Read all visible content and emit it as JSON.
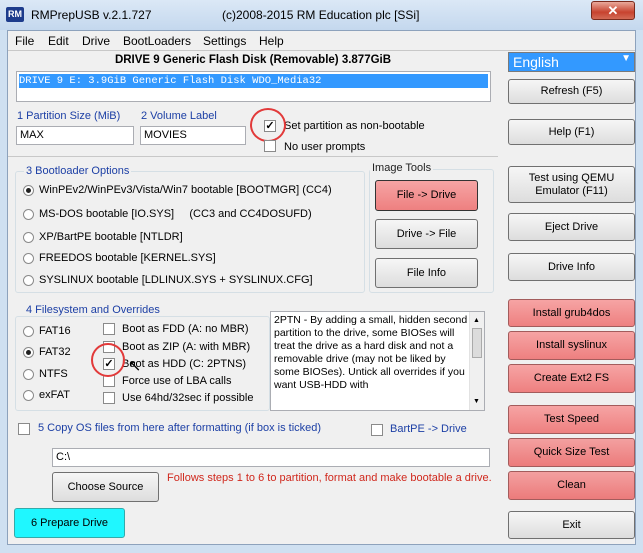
{
  "window": {
    "title": "RMPrepUSB v.2.1.727",
    "copyright": "(c)2008-2015 RM Education plc [SSi]",
    "icon": "RM",
    "close": "✕"
  },
  "menu": [
    "File",
    "Edit",
    "Drive",
    "BootLoaders",
    "Settings",
    "Help"
  ],
  "drive_header": "DRIVE 9 Generic Flash Disk  (Removable) 3.877GiB",
  "drive_row": "DRIVE 9   E:     3.9GiB  Generic Flash Disk            WDO_Media32",
  "language": "English",
  "partition": {
    "size_label": "1 Partition Size (MiB)",
    "size_value": "MAX",
    "volume_label": "2 Volume Label",
    "volume_value": "MOVIES"
  },
  "options": {
    "non_bootable": "Set partition as non-bootable",
    "no_prompts": "No user prompts"
  },
  "bootloader": {
    "title": "3 Bootloader Options",
    "items": [
      "WinPEv2/WinPEv3/Vista/Win7 bootable [BOOTMGR] (CC4)",
      "MS-DOS bootable [IO.SYS]     (CC3 and CC4DOSUFD)",
      "XP/BartPE bootable [NTLDR]",
      "FREEDOS bootable [KERNEL.SYS]",
      "SYSLINUX bootable [LDLINUX.SYS + SYSLINUX.CFG]"
    ]
  },
  "image_tools": {
    "title": "Image Tools",
    "file_to_drive": "File -> Drive",
    "drive_to_file": "Drive -> File",
    "file_info": "File Info"
  },
  "filesystem": {
    "title": "4 Filesystem and Overrides",
    "fs": [
      "FAT16",
      "FAT32",
      "NTFS",
      "exFAT"
    ],
    "overrides": [
      "Boot as FDD (A: no MBR)",
      "Boot as ZIP (A: with MBR)",
      "Boot as HDD (C: 2PTNS)",
      "Force use of LBA calls",
      "Use 64hd/32sec if possible"
    ]
  },
  "help_text": "2PTN - By adding a small, hidden second partition to the drive, some BIOSes will treat the drive as a hard disk and not a removable drive (may not be liked by some BIOSes). Untick all overrides if you want USB-HDD with",
  "copy_os": "5 Copy OS files from here after formatting (if box is ticked)",
  "bartpe": "BartPE -> Drive",
  "path_value": "C:\\",
  "choose_source": "Choose Source",
  "instruction": "Follows steps 1 to 6 to partition, format and make bootable a drive.",
  "prepare": "6 Prepare Drive",
  "right_buttons": {
    "refresh": "Refresh (F5)",
    "help": "Help (F1)",
    "qemu": "Test using QEMU Emulator (F11)",
    "eject": "Eject Drive",
    "drive_info": "Drive Info",
    "grub4dos": "Install grub4dos",
    "syslinux": "Install syslinux",
    "ext2": "Create Ext2 FS",
    "speed": "Test Speed",
    "quick_size": "Quick Size Test",
    "clean": "Clean",
    "exit": "Exit"
  },
  "colors": {
    "accent_red": "#ee8080",
    "selection_blue": "#3399ff",
    "prepare_cyan": "#1ff7ff",
    "label_blue": "#1c3fa5"
  }
}
